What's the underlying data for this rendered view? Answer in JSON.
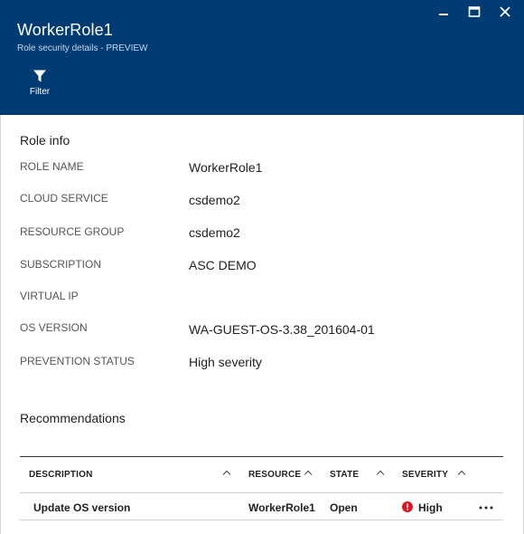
{
  "window": {
    "controls": [
      "minimize",
      "maximize",
      "close"
    ]
  },
  "header": {
    "title": "WorkerRole1",
    "subtitle": "Role security details - PREVIEW",
    "commands": [
      {
        "label": "Filter",
        "icon": "filter-icon"
      }
    ]
  },
  "role_info": {
    "section_title": "Role info",
    "properties": [
      {
        "label": "ROLE NAME",
        "value": "WorkerRole1"
      },
      {
        "label": "CLOUD SERVICE",
        "value": "csdemo2"
      },
      {
        "label": "RESOURCE GROUP",
        "value": "csdemo2"
      },
      {
        "label": "SUBSCRIPTION",
        "value": "ASC DEMO"
      },
      {
        "label": "VIRTUAL IP",
        "value": ""
      },
      {
        "label": "OS VERSION",
        "value": "WA-GUEST-OS-3.38_201604-01"
      },
      {
        "label": "PREVENTION STATUS",
        "value": "High severity"
      }
    ]
  },
  "recommendations": {
    "section_title": "Recommendations",
    "columns": [
      "DESCRIPTION",
      "RESOURCE",
      "STATE",
      "SEVERITY"
    ],
    "rows": [
      {
        "description": "Update OS version",
        "resource": "WorkerRole1",
        "state": "Open",
        "severity": "High",
        "more": "..."
      }
    ]
  },
  "colors": {
    "header_bg": "#003b73",
    "severity_high": "#e81123"
  }
}
